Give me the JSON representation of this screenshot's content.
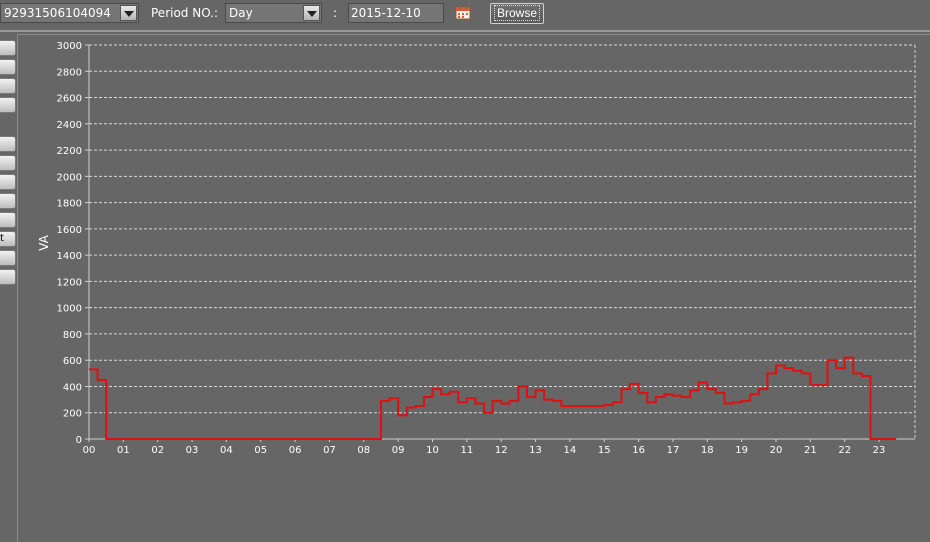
{
  "toolbar": {
    "meter_id": "92931506104094",
    "period_label": "Period NO.:",
    "period_value": "Day",
    "separator": ":",
    "date_value": "2015-12-10",
    "browse_label": "Browse"
  },
  "side_tabs": [
    {
      "label": ""
    },
    {
      "label": ""
    },
    {
      "label": ""
    },
    {
      "label": ""
    },
    {
      "label": ""
    },
    {
      "label": ""
    },
    {
      "label": ""
    },
    {
      "label": ""
    },
    {
      "label": ""
    },
    {
      "label": "t"
    },
    {
      "label": ""
    },
    {
      "label": ""
    }
  ],
  "chart_data": {
    "type": "line",
    "step": true,
    "ylabel": "VA",
    "xlabel": "",
    "ylim": [
      0,
      3000
    ],
    "xlim": [
      0,
      24
    ],
    "yticks": [
      "0",
      "200",
      "400",
      "600",
      "800",
      "1000",
      "1200",
      "1400",
      "1600",
      "1800",
      "2000",
      "2200",
      "2400",
      "2600",
      "2800",
      "3000"
    ],
    "xticks": [
      "00",
      "01",
      "02",
      "03",
      "04",
      "05",
      "06",
      "07",
      "08",
      "09",
      "10",
      "11",
      "12",
      "13",
      "14",
      "15",
      "16",
      "17",
      "18",
      "19",
      "20",
      "21",
      "22",
      "23"
    ],
    "grid": true,
    "line_color": "#e01010",
    "series": [
      {
        "x": [
          0,
          0.25,
          0.5,
          0.75,
          8.5,
          8.75,
          9,
          9.25,
          9.5,
          9.75,
          10,
          10.25,
          10.5,
          10.75,
          11,
          11.25,
          11.5,
          11.75,
          12,
          12.25,
          12.5,
          12.75,
          13,
          13.25,
          13.5,
          13.75,
          14,
          14.25,
          14.5,
          14.75,
          15,
          15.25,
          15.5,
          15.75,
          16,
          16.25,
          16.5,
          16.75,
          17,
          17.25,
          17.5,
          17.75,
          18,
          18.25,
          18.5,
          18.75,
          19,
          19.25,
          19.5,
          19.75,
          20,
          20.25,
          20.5,
          20.75,
          21,
          21.25,
          21.5,
          21.75,
          22,
          22.25,
          22.5,
          22.75,
          23.5
        ],
        "y": [
          530,
          450,
          0,
          0,
          290,
          310,
          180,
          240,
          250,
          320,
          380,
          340,
          360,
          280,
          310,
          270,
          200,
          290,
          270,
          290,
          400,
          320,
          370,
          300,
          290,
          250,
          250,
          250,
          250,
          250,
          260,
          280,
          380,
          420,
          350,
          280,
          320,
          340,
          330,
          320,
          370,
          430,
          380,
          350,
          270,
          280,
          290,
          340,
          380,
          500,
          560,
          540,
          520,
          500,
          410,
          410,
          600,
          540,
          620,
          500,
          480,
          0,
          0
        ]
      }
    ]
  }
}
